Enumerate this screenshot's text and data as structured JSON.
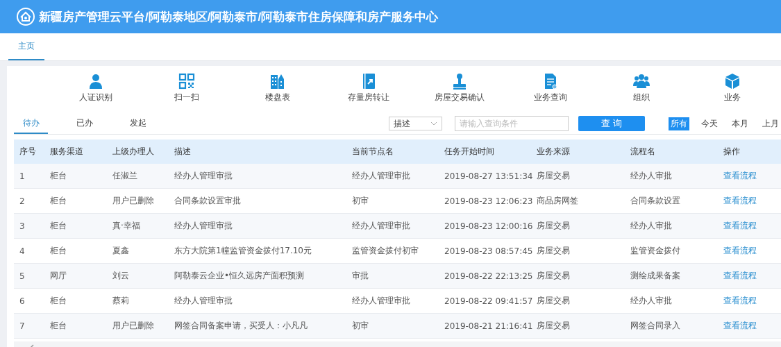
{
  "header": {
    "title": "新疆房产管理云平台/阿勒泰地区/阿勒泰市/阿勒泰市住房保障和房产服务中心"
  },
  "page_tabs": [
    {
      "label": "主页",
      "selected": true
    }
  ],
  "shortcuts": [
    {
      "kind": "person",
      "label": "人证识别"
    },
    {
      "kind": "qr",
      "label": "扫一扫"
    },
    {
      "kind": "buildings",
      "label": "楼盘表"
    },
    {
      "kind": "book",
      "label": "存量房转让"
    },
    {
      "kind": "stamp",
      "label": "房屋交易确认"
    },
    {
      "kind": "document",
      "label": "业务查询"
    },
    {
      "kind": "group",
      "label": "组织"
    },
    {
      "kind": "cube",
      "label": "业务"
    }
  ],
  "task_tabs": [
    {
      "label": "待办",
      "selected": true
    },
    {
      "label": "已办",
      "selected": false
    },
    {
      "label": "发起",
      "selected": false
    }
  ],
  "search": {
    "field_select": "描述",
    "placeholder": "请输入查询条件",
    "button": "查 询"
  },
  "period_filters": [
    {
      "label": "所有",
      "selected": true
    },
    {
      "label": "今天",
      "selected": false
    },
    {
      "label": "本月",
      "selected": false
    },
    {
      "label": "上月",
      "selected": false
    }
  ],
  "table": {
    "columns": [
      "序号",
      "服务渠道",
      "上级办理人",
      "描述",
      "当前节点名",
      "任务开始时间",
      "业务来源",
      "流程名",
      "操作"
    ],
    "rows": [
      [
        "1",
        "柜台",
        "任淑兰",
        "经办人管理审批",
        "经办人管理审批",
        "2019-08-27 13:51:34",
        "房屋交易",
        "经办人审批",
        "查看流程"
      ],
      [
        "2",
        "柜台",
        "用户已删除",
        "合同条款设置审批",
        "初审",
        "2019-08-23 12:06:23",
        "商品房网签",
        "合同条款设置",
        "查看流程"
      ],
      [
        "3",
        "柜台",
        "真·幸福",
        "经办人管理审批",
        "经办人管理审批",
        "2019-08-23 12:00:16",
        "房屋交易",
        "经办人审批",
        "查看流程"
      ],
      [
        "4",
        "柜台",
        "夏鑫",
        "东方大院第1幢监管资金拨付17.10元",
        "监管资金拨付初审",
        "2019-08-23 08:57:45",
        "房屋交易",
        "监管资金拨付",
        "查看流程"
      ],
      [
        "5",
        "网厅",
        "刘云",
        "阿勒泰云企业•恒久远房产面积预测",
        "审批",
        "2019-08-22 22:13:25",
        "房屋交易",
        "测绘成果备案",
        "查看流程"
      ],
      [
        "6",
        "柜台",
        "蔡莉",
        "经办人管理审批",
        "经办人管理审批",
        "2019-08-22 09:41:57",
        "房屋交易",
        "经办人审批",
        "查看流程"
      ],
      [
        "7",
        "柜台",
        "用户已删除",
        "网签合同备案申请，买受人：小凡凡",
        "初审",
        "2019-08-21 21:16:41",
        "房屋交易",
        "网签合同录入",
        "查看流程"
      ]
    ]
  }
}
